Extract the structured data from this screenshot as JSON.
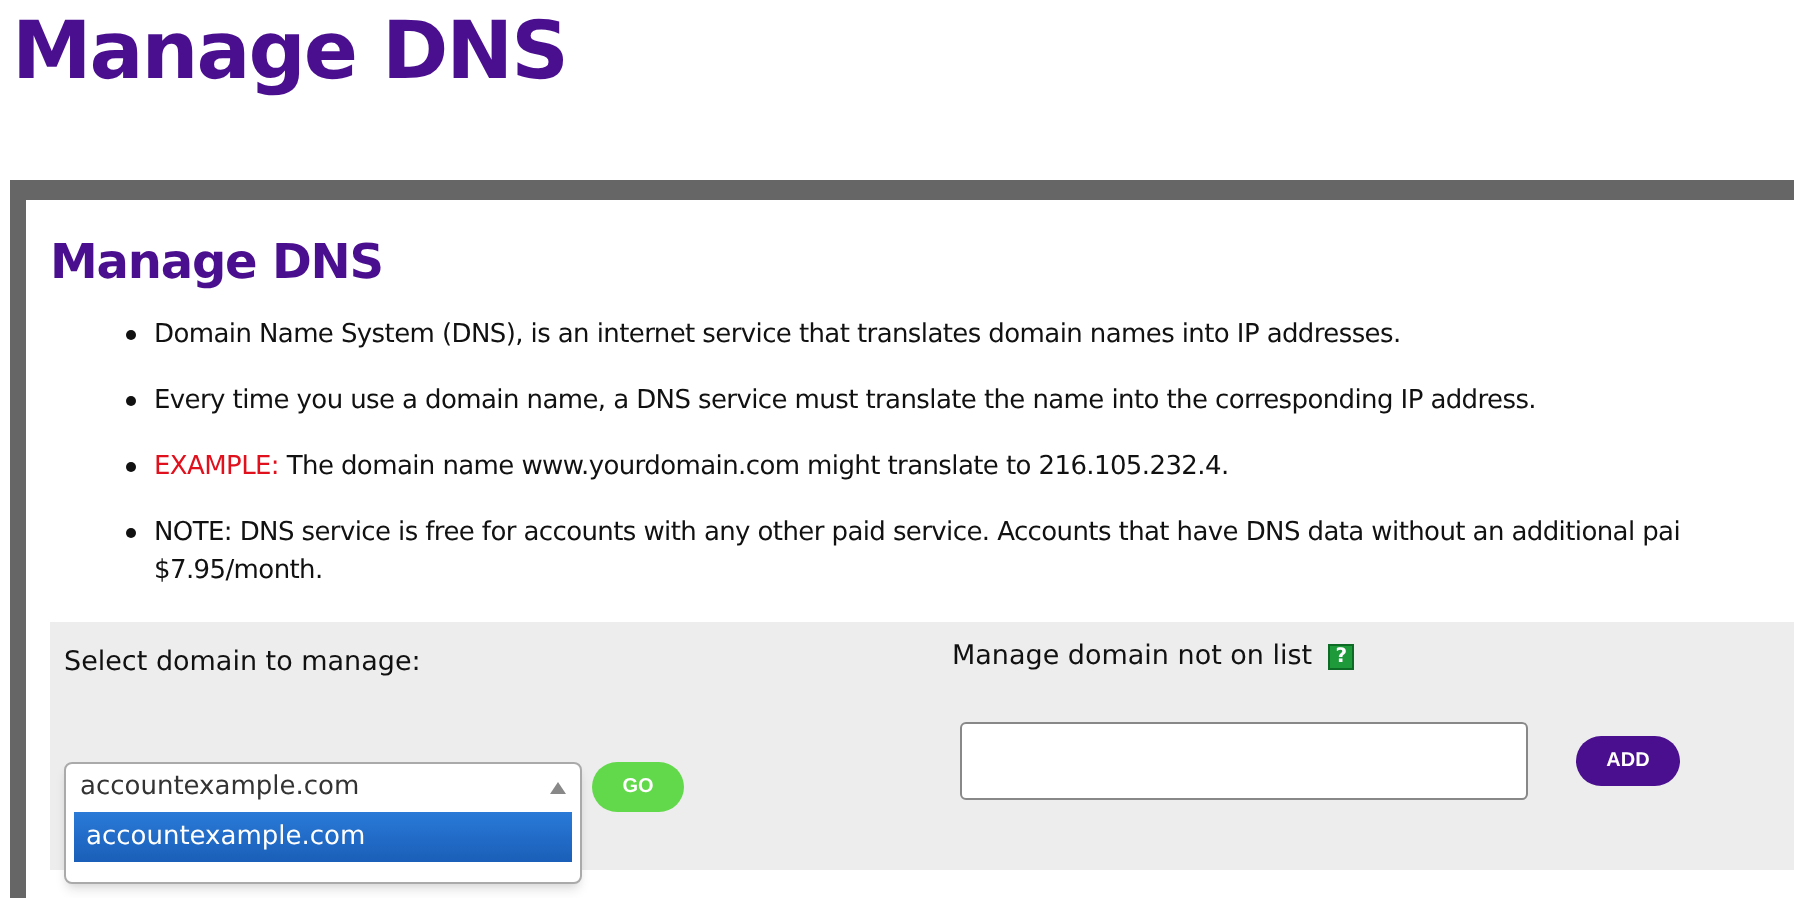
{
  "page_title": "Manage DNS",
  "panel": {
    "heading": "Manage DNS",
    "bullets": [
      {
        "kind": "plain",
        "text": "Domain Name System (DNS), is an internet service that translates domain names into IP addresses."
      },
      {
        "kind": "plain",
        "text": "Every time you use a domain name, a DNS service must translate the name into the corresponding IP address."
      },
      {
        "kind": "example",
        "label": "EXAMPLE:",
        "text": "The domain name www.yourdomain.com might translate to 216.105.232.4."
      },
      {
        "kind": "plain",
        "text": "NOTE: DNS service is free for accounts with any other paid service. Accounts that have DNS data without an additional pai",
        "continuation": "$7.95/month."
      }
    ]
  },
  "select_domain": {
    "label": "Select domain to manage:",
    "value": "accountexample.com",
    "expanded": true,
    "options": [
      {
        "label": "accountexample.com",
        "selected": true
      }
    ],
    "button": "GO"
  },
  "other_domain": {
    "label": "Manage domain not on list",
    "help": "?",
    "button": "ADD"
  }
}
